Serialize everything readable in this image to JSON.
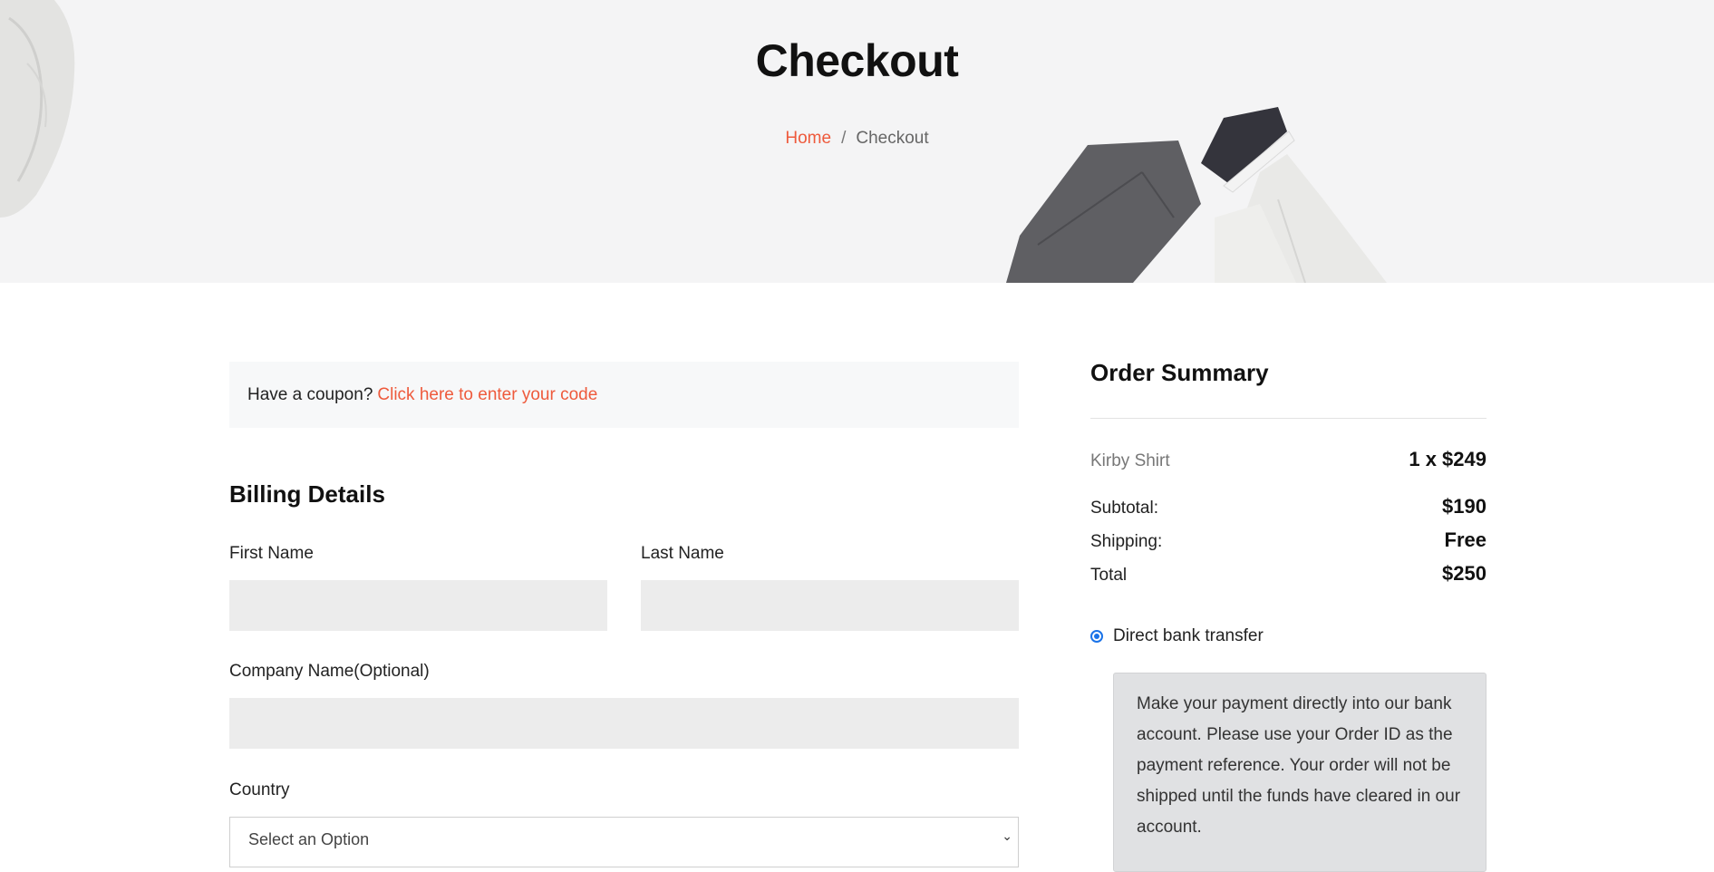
{
  "hero": {
    "title": "Checkout",
    "breadcrumb": {
      "home": "Home",
      "separator": "/",
      "current": "Checkout"
    }
  },
  "coupon": {
    "prompt": "Have a coupon?",
    "link": "Click here to enter your code"
  },
  "billing": {
    "title": "Billing Details",
    "first_name_label": "First Name",
    "last_name_label": "Last Name",
    "company_label": "Company Name(Optional)",
    "country_label": "Country",
    "country_select_value": "Select an Option"
  },
  "summary": {
    "title": "Order Summary",
    "item_name": "Kirby Shirt",
    "item_value": "1 x $249",
    "subtotal_label": "Subtotal:",
    "subtotal_value": "$190",
    "shipping_label": "Shipping:",
    "shipping_value": "Free",
    "total_label": "Total",
    "total_value": "$250",
    "payment_option": "Direct bank transfer",
    "payment_note": "Make your payment directly into our bank account. Please use your Order ID as the payment reference. Your order will not be shipped until the funds have cleared in our account."
  },
  "colors": {
    "accent": "#ee5a3c",
    "hero_bg": "#f4f4f5",
    "input_bg": "#ececec",
    "note_bg": "#e0e1e3",
    "radio": "#1a73e8"
  },
  "icons": {
    "select_caret": "chevron-down-icon",
    "radio": "radio-selected-icon"
  }
}
